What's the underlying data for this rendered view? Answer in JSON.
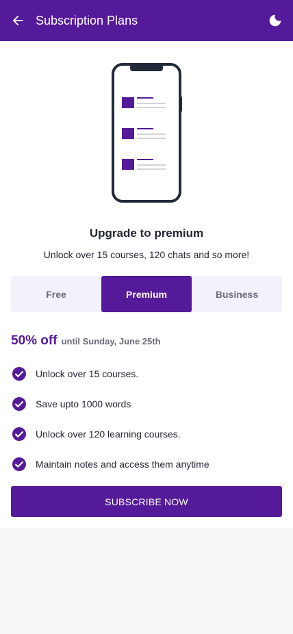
{
  "appbar": {
    "title": "Subscription Plans",
    "back_icon": "arrow-left-icon",
    "theme_icon": "moon-icon"
  },
  "colors": {
    "primary": "#551a99",
    "tab_bg": "#f3f1fa",
    "text": "#1f2430",
    "muted": "#6b6b78"
  },
  "hero": {
    "illustration": "phone-list-illustration",
    "headline": "Upgrade to premium",
    "subline": "Unlock over 15 courses, 120 chats and so more!"
  },
  "plans": {
    "tabs": [
      "Free",
      "Premium",
      "Business"
    ],
    "selected": "Premium"
  },
  "offer": {
    "discount": "50% off",
    "until": "until Sunday, June 25th"
  },
  "features": [
    "Unlock over 15 courses.",
    "Save upto 1000 words",
    "Unlock over 120 learning courses.",
    "Maintain notes and access them anytime"
  ],
  "cta": {
    "label": "SUBSCRIBE NOW"
  }
}
